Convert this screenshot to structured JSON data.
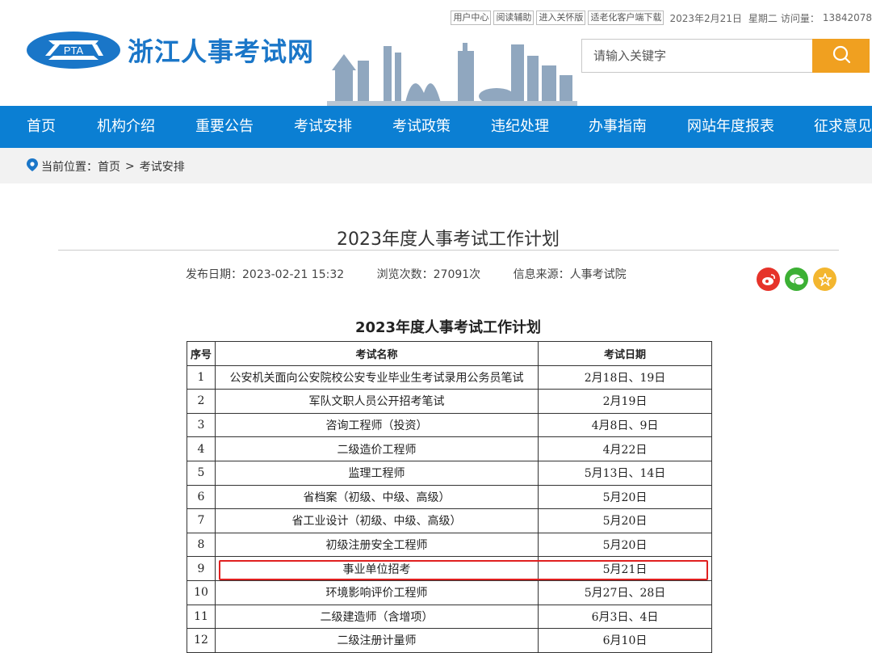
{
  "topbar": {
    "links": [
      "用户中心",
      "阅读辅助",
      "进入关怀版",
      "适老化客户端下载"
    ],
    "date": "2023年2月21日",
    "weekday": "星期二",
    "visits_label": "访问量：",
    "visits": "13842078"
  },
  "logo": {
    "emblem_text": "PTA",
    "title": "浙江人事考试网"
  },
  "search": {
    "placeholder": "请输入关键字",
    "button_icon": "search-icon"
  },
  "nav": [
    "首页",
    "机构介绍",
    "重要公告",
    "考试安排",
    "考试政策",
    "违纪处理",
    "办事指南",
    "网站年度报表",
    "征求意见"
  ],
  "breadcrumb": {
    "label": "当前位置：",
    "items": [
      "首页",
      "考试安排"
    ],
    "separator": ">"
  },
  "article": {
    "title": "2023年度人事考试工作计划",
    "publish_date": "发布日期：2023-02-21 15:32",
    "views": "浏览次数：27091次",
    "source": "信息来源：人事考试院"
  },
  "share": {
    "icons": [
      "weibo-icon",
      "wechat-icon",
      "favorite-icon"
    ],
    "colors": [
      "#e6332a",
      "#3cb034",
      "#f3b62f"
    ]
  },
  "table": {
    "title": "2023年度人事考试工作计划",
    "headers": [
      "序号",
      "考试名称",
      "考试日期"
    ],
    "rows": [
      [
        "1",
        "公安机关面向公安院校公安专业毕业生考试录用公务员笔试",
        "2月18日、19日"
      ],
      [
        "2",
        "军队文职人员公开招考笔试",
        "2月19日"
      ],
      [
        "3",
        "咨询工程师（投资）",
        "4月8日、9日"
      ],
      [
        "4",
        "二级造价工程师",
        "4月22日"
      ],
      [
        "5",
        "监理工程师",
        "5月13日、14日"
      ],
      [
        "6",
        "省档案（初级、中级、高级）",
        "5月20日"
      ],
      [
        "7",
        "省工业设计（初级、中级、高级）",
        "5月20日"
      ],
      [
        "8",
        "初级注册安全工程师",
        "5月20日"
      ],
      [
        "9",
        "事业单位招考",
        "5月21日"
      ],
      [
        "10",
        "环境影响评价工程师",
        "5月27日、28日"
      ],
      [
        "11",
        "二级建造师（含增项）",
        "6月3日、4日"
      ],
      [
        "12",
        "二级注册计量师",
        "6月10日"
      ]
    ],
    "highlight_color": "#e02020"
  },
  "colors": {
    "brand": "#1a76c8",
    "nav": "#0b7fd3",
    "search_button": "#f0a020"
  }
}
